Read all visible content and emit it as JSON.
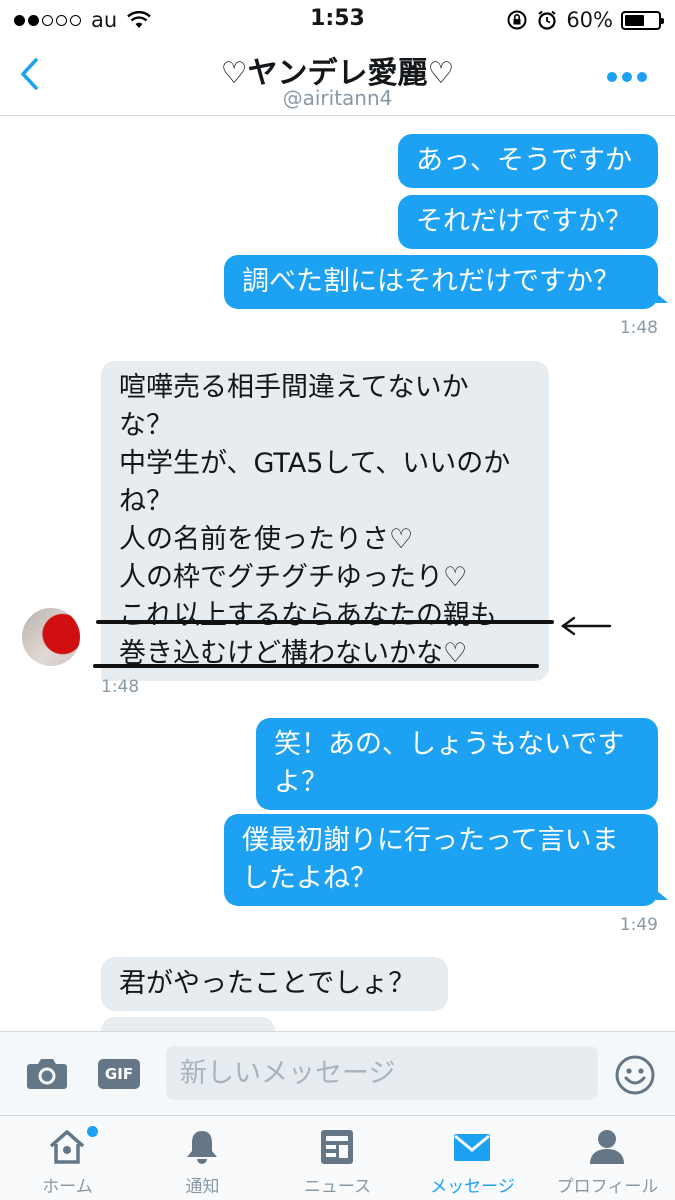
{
  "status_bar": {
    "signal_dots": [
      true,
      true,
      false,
      false,
      false
    ],
    "carrier": "au",
    "time": "1:53",
    "battery": "60%",
    "battery_level": 0.6
  },
  "header": {
    "title": "♡ヤンデレ愛麗♡",
    "handle": "@airitann4"
  },
  "messages": {
    "m1": "あっ、そうですか",
    "m2": "それだけですか？",
    "m3": "調べた割にはそれだけですか？",
    "ts1": "1:48",
    "m4": "喧嘩売る相手間違えてないか\nな？\n中学生が、GTA5して、いいのか\nね？\n人の名前を使ったりさ♡\n人の枠でグチグチゆったり♡\nこれ以上するならあなたの親も\n巻き込むけど構わないかな♡",
    "ts2": "1:48",
    "m5": "笑！あの、しょうもないです\nよ？",
    "m6": "僕最初謝りに行ったって言いま\nしたよね？",
    "ts3": "1:49",
    "m7": "君がやったことでしょ？"
  },
  "compose": {
    "gif_label": "GIF",
    "placeholder": "新しいメッセージ"
  },
  "tabs": {
    "home": "ホーム",
    "notifications": "通知",
    "news": "ニュース",
    "messages": "メッセージ",
    "profile": "プロフィール"
  },
  "colors": {
    "accent": "#1da1f2",
    "received_bubble": "#e6ecf0",
    "muted_text": "#8899a6"
  }
}
